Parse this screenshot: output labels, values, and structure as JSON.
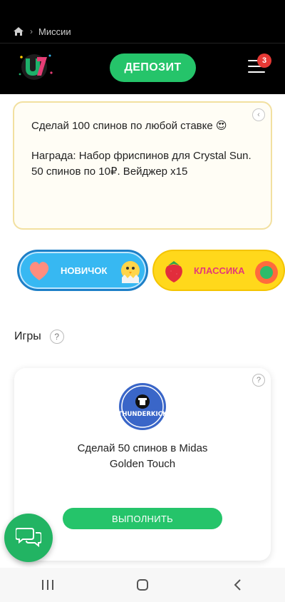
{
  "header": {
    "breadcrumb": {
      "home_icon": "home-icon",
      "separator": "›",
      "current": "Миссии"
    },
    "deposit_label": "ДЕПОЗИТ",
    "menu_badge_count": "3"
  },
  "mission": {
    "text": "Сделай 100 спинов по любой ставке 😍",
    "reward": "Награда: Набор фриспинов для Crystal Sun. 50 спинов по 10₽. Вейджер х15",
    "collapse_icon": "chevron-left-icon"
  },
  "categories": [
    {
      "label": "НОВИЧОК",
      "color": "#37b8f2"
    },
    {
      "label": "КЛАССИКА",
      "color": "#ffd81b"
    }
  ],
  "games_section": {
    "title": "Игры",
    "help": "?"
  },
  "game_card": {
    "provider": "THUNDERKICK",
    "description_line1": "Сделай 50 спинов в Midas",
    "description_line2": "Golden Touch",
    "action_label": "ВЫПОЛНИТЬ",
    "help": "?"
  },
  "colors": {
    "accent_green": "#25c46a",
    "badge_red": "#e53935"
  }
}
